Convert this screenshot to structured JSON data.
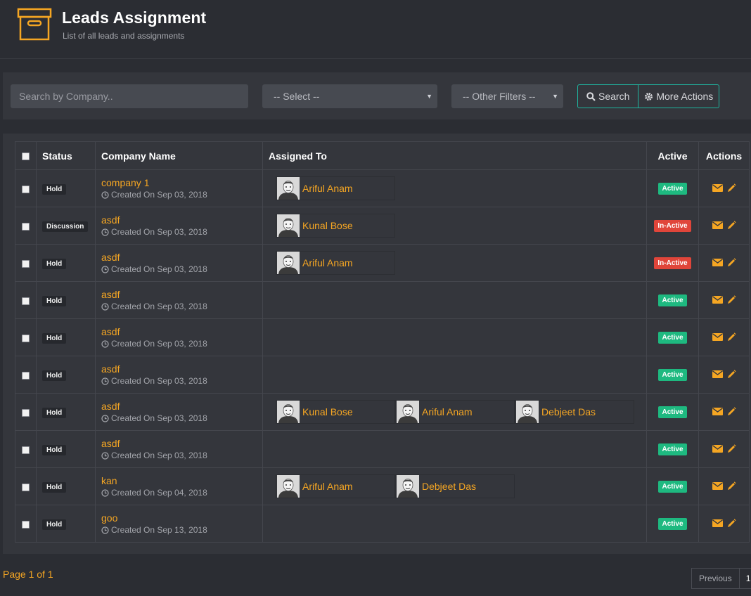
{
  "header": {
    "title": "Leads Assignment",
    "subtitle": "List of all leads and assignments",
    "icon": "archive-box-icon",
    "accent_color": "#f5a623"
  },
  "filters": {
    "search_placeholder": "Search by Company..",
    "select_value": "-- Select --",
    "other_filters_value": "-- Other Filters --",
    "search_button": "Search",
    "more_actions_button": "More Actions"
  },
  "table": {
    "columns": [
      "Status",
      "Company Name",
      "Assigned To",
      "Active",
      "Actions"
    ],
    "rows": [
      {
        "status": "Hold",
        "company": "company 1",
        "created": "Created On Sep 03, 2018",
        "assigned": [
          "Ariful Anam"
        ],
        "active": "Active"
      },
      {
        "status": "Discussion",
        "company": "asdf",
        "created": "Created On Sep 03, 2018",
        "assigned": [
          "Kunal Bose"
        ],
        "active": "In-Active"
      },
      {
        "status": "Hold",
        "company": "asdf",
        "created": "Created On Sep 03, 2018",
        "assigned": [
          "Ariful Anam"
        ],
        "active": "In-Active"
      },
      {
        "status": "Hold",
        "company": "asdf",
        "created": "Created On Sep 03, 2018",
        "assigned": [],
        "active": "Active"
      },
      {
        "status": "Hold",
        "company": "asdf",
        "created": "Created On Sep 03, 2018",
        "assigned": [],
        "active": "Active"
      },
      {
        "status": "Hold",
        "company": "asdf",
        "created": "Created On Sep 03, 2018",
        "assigned": [],
        "active": "Active"
      },
      {
        "status": "Hold",
        "company": "asdf",
        "created": "Created On Sep 03, 2018",
        "assigned": [
          "Kunal Bose",
          "Ariful Anam",
          "Debjeet Das"
        ],
        "active": "Active"
      },
      {
        "status": "Hold",
        "company": "asdf",
        "created": "Created On Sep 03, 2018",
        "assigned": [],
        "active": "Active"
      },
      {
        "status": "Hold",
        "company": "kan",
        "created": "Created On Sep 04, 2018",
        "assigned": [
          "Ariful Anam",
          "Debjeet Das"
        ],
        "active": "Active"
      },
      {
        "status": "Hold",
        "company": "goo",
        "created": "Created On Sep 13, 2018",
        "assigned": [],
        "active": "Active"
      }
    ]
  },
  "pagination": {
    "page_info": "Page 1 of 1",
    "previous_label": "Previous",
    "current_page": "1"
  }
}
